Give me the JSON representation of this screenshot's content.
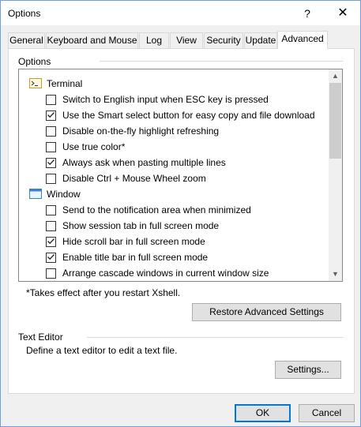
{
  "window": {
    "title": "Options",
    "help_glyph": "?",
    "close_glyph": "✕"
  },
  "tabs": [
    {
      "label": "General",
      "active": false
    },
    {
      "label": "Keyboard and Mouse",
      "active": false
    },
    {
      "label": "Log",
      "active": false
    },
    {
      "label": "View",
      "active": false
    },
    {
      "label": "Security",
      "active": false
    },
    {
      "label": "Update",
      "active": false
    },
    {
      "label": "Advanced",
      "active": true
    }
  ],
  "options_group": {
    "label": "Options"
  },
  "list": {
    "terminal": {
      "label": "Terminal",
      "icon": "terminal-icon",
      "items": [
        {
          "label": "Switch to English input when ESC key is pressed",
          "checked": false
        },
        {
          "label": "Use the Smart select button for easy copy and file download",
          "checked": true
        },
        {
          "label": "Disable on-the-fly highlight refreshing",
          "checked": false
        },
        {
          "label": "Use true color*",
          "checked": false
        },
        {
          "label": "Always ask when pasting multiple lines",
          "checked": true
        },
        {
          "label": "Disable Ctrl + Mouse Wheel zoom",
          "checked": false
        }
      ]
    },
    "window": {
      "label": "Window",
      "icon": "window-icon",
      "items": [
        {
          "label": "Send to the notification area when minimized",
          "checked": false
        },
        {
          "label": "Show session tab in full screen mode",
          "checked": false
        },
        {
          "label": "Hide scroll bar in full screen mode",
          "checked": true
        },
        {
          "label": "Enable title bar in full screen mode",
          "checked": true
        },
        {
          "label": "Arrange cascade windows in current window size",
          "checked": false
        }
      ]
    }
  },
  "note": "*Takes effect after you restart Xshell.",
  "restore_button": "Restore Advanced Settings",
  "text_editor": {
    "label": "Text Editor",
    "description": "Define a text editor to edit a text file.",
    "settings_button": "Settings..."
  },
  "footer": {
    "ok": "OK",
    "cancel": "Cancel"
  }
}
